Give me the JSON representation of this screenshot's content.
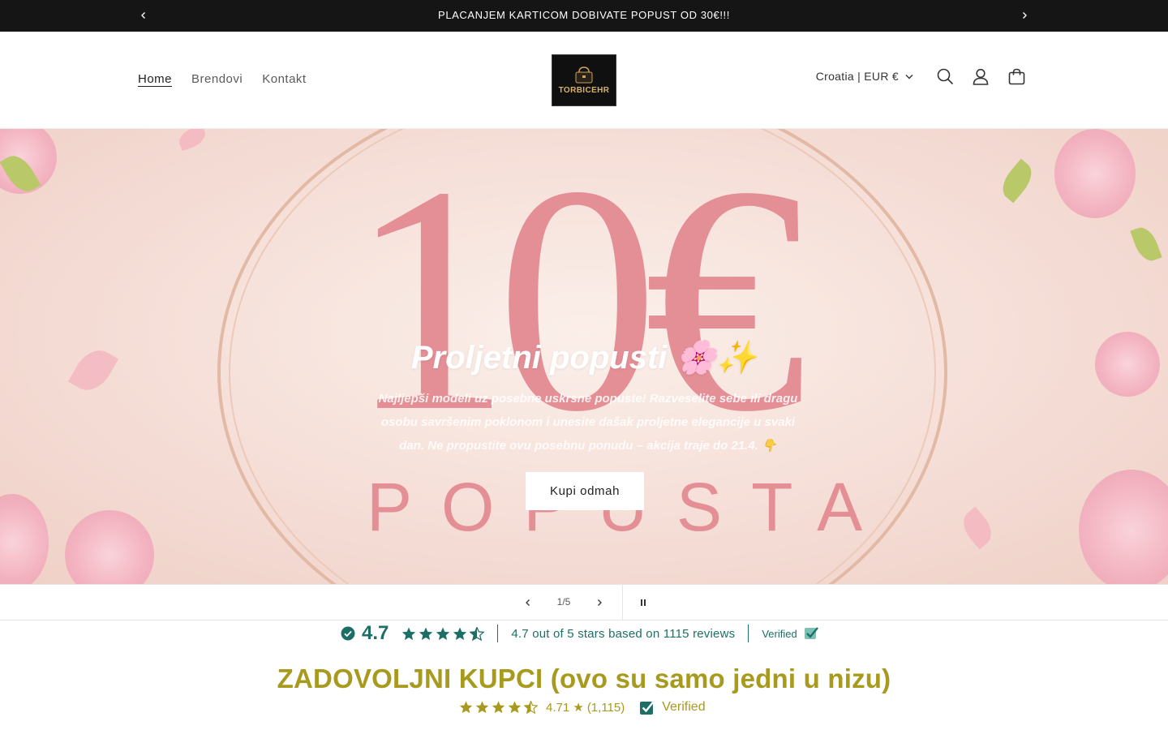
{
  "announcement": {
    "text": "PLACANJEM KARTICOM DOBIVATE POPUST OD 30€!!!"
  },
  "header": {
    "nav": [
      {
        "label": "Home",
        "active": true
      },
      {
        "label": "Brendovi",
        "active": false
      },
      {
        "label": "Kontakt",
        "active": false
      }
    ],
    "logo_text": "TORBICEHR",
    "country_selector": "Croatia | EUR €"
  },
  "hero": {
    "big_text": "10€",
    "big_subtext": "POPUSTA",
    "title": "Proljetni popusti 🌸✨",
    "description": "Najljepši modeli uz posebne uskrsne popuste! Razveselite sebe ili dragu osobu savršenim poklonom i unesite dašak proljetne elegancije u svaki dan. Ne propustite ovu posebnu ponudu – akcija traje do 21.4. 👇",
    "cta_label": "Kupi odmah"
  },
  "slider": {
    "counter": "1/5",
    "current": 1,
    "total": 5
  },
  "rating_bar": {
    "score": "4.7",
    "text": "4.7 out of 5 stars based on 1115 reviews",
    "verified": "Verified",
    "stars": 4.7
  },
  "reviews": {
    "heading": "ZADOVOLJNI KUPCI (ovo su samo jedni u nizu)",
    "score_text": "4.71 ★",
    "count_text": "(1,115)",
    "verified": "Verified",
    "stars": 4.71
  },
  "colors": {
    "announcement_bg": "#151515",
    "rating_teal": "#1d6f66",
    "reviews_gold": "#a89a1e",
    "hero_pink": "#e48e96"
  }
}
